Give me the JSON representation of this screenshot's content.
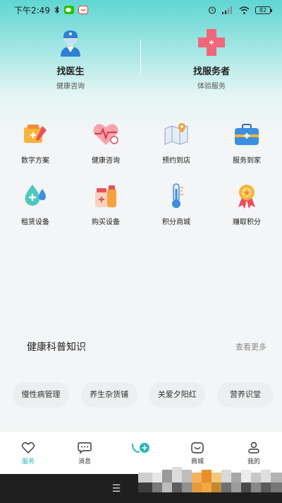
{
  "status_bar": {
    "time": "下午2:49",
    "battery": "82"
  },
  "top_cards": [
    {
      "title": "找医生",
      "subtitle": "健康咨询",
      "icon": "doctor-icon"
    },
    {
      "title": "找服务者",
      "subtitle": "体验服务",
      "icon": "medical-cross-icon"
    }
  ],
  "grid": [
    {
      "label": "数字方案",
      "icon": "digital-plan-icon"
    },
    {
      "label": "健康咨询",
      "icon": "heart-consult-icon"
    },
    {
      "label": "预约到店",
      "icon": "map-pin-icon"
    },
    {
      "label": "服务到家",
      "icon": "medical-kit-icon"
    },
    {
      "label": "租赁设备",
      "icon": "water-drop-icon"
    },
    {
      "label": "购买设备",
      "icon": "medicine-bottle-icon"
    },
    {
      "label": "积分商城",
      "icon": "thermometer-icon"
    },
    {
      "label": "赚取积分",
      "icon": "award-ribbon-icon"
    }
  ],
  "knowledge": {
    "title": "健康科普知识",
    "more": "查看更多",
    "tags": [
      "慢性病管理",
      "养生杂货铺",
      "关爱夕阳红",
      "营养识堂"
    ]
  },
  "bottom_nav": [
    {
      "label": "服务",
      "icon": "heart-outline-icon",
      "active": true
    },
    {
      "label": "消息",
      "icon": "chat-bubble-icon",
      "active": false
    },
    {
      "label": "",
      "icon": "center-add-icon",
      "active": false
    },
    {
      "label": "商城",
      "icon": "smile-bag-icon",
      "active": false
    },
    {
      "label": "我的",
      "icon": "user-icon",
      "active": false
    }
  ],
  "colors": {
    "accent": "#2bb8b0",
    "hero_top": "#5fd6d2",
    "page_bg": "#f4f5f6"
  }
}
